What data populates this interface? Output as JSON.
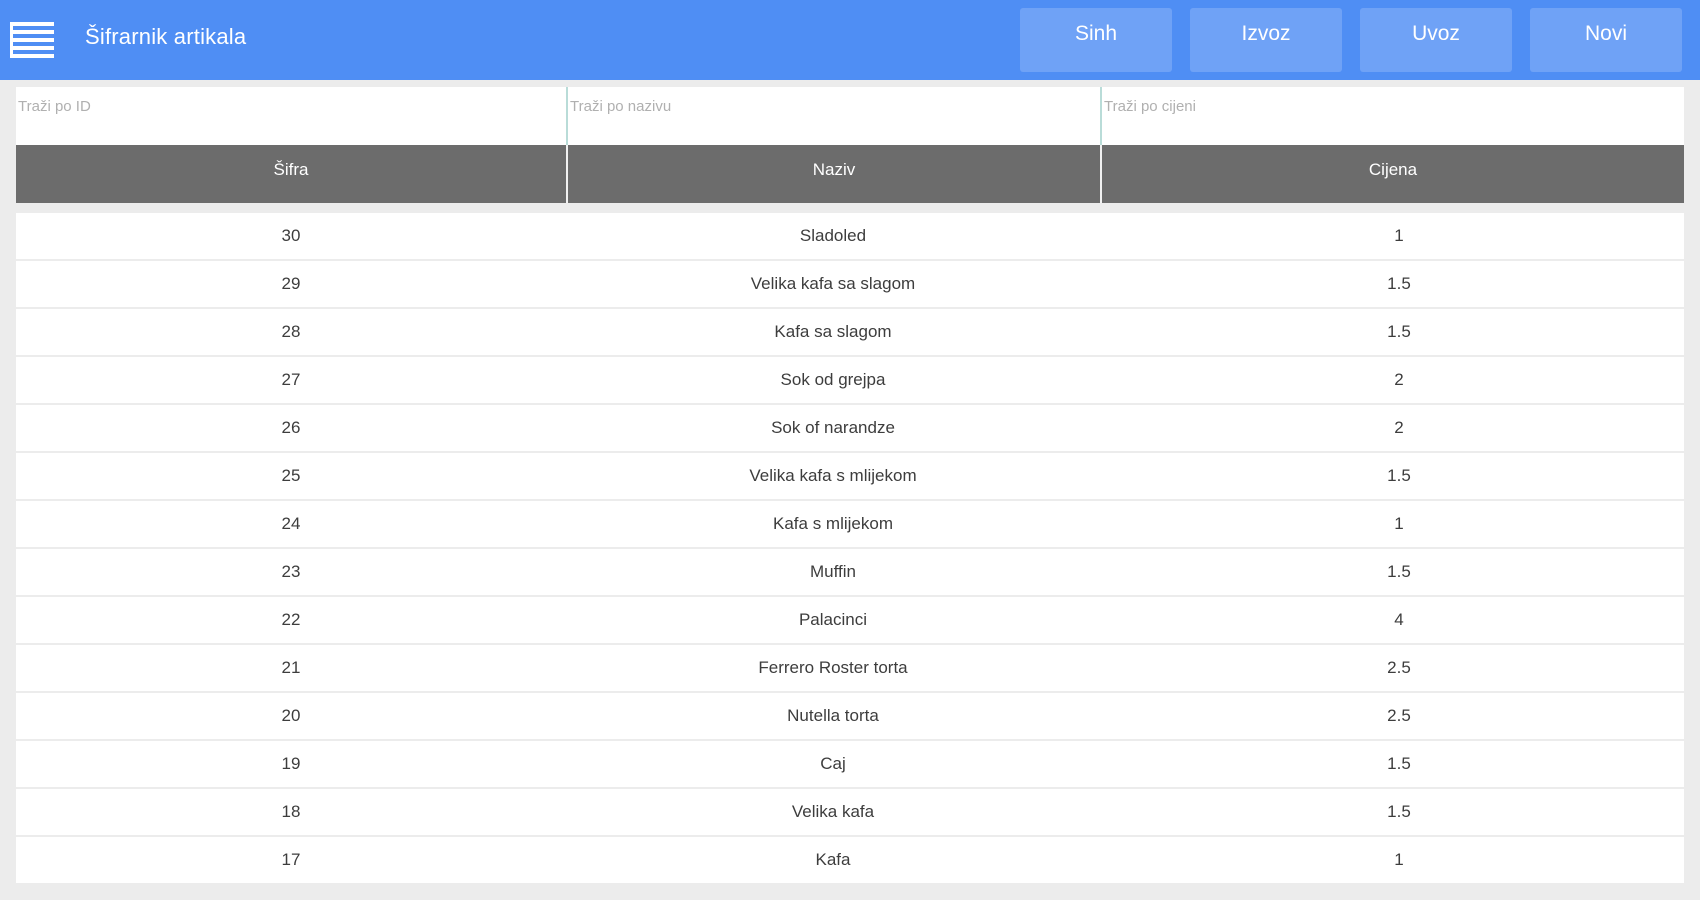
{
  "header": {
    "title": "Šifrarnik artikala",
    "menu_icon": "hamburger-menu-icon",
    "accent_color": "#4f8ef4",
    "buttons": [
      {
        "id": "sync",
        "label": "Sinh"
      },
      {
        "id": "export",
        "label": "Izvoz"
      },
      {
        "id": "import",
        "label": "Uvoz"
      },
      {
        "id": "new",
        "label": "Novi"
      }
    ]
  },
  "filters": {
    "id_placeholder": "Traži po ID",
    "name_placeholder": "Traži po nazivu",
    "price_placeholder": "Traži po cijeni"
  },
  "table": {
    "columns": [
      "Šifra",
      "Naziv",
      "Cijena"
    ],
    "rows": [
      {
        "sifra": "30",
        "naziv": "Sladoled",
        "cijena": "1"
      },
      {
        "sifra": "29",
        "naziv": "Velika kafa sa slagom",
        "cijena": "1.5"
      },
      {
        "sifra": "28",
        "naziv": "Kafa sa slagom",
        "cijena": "1.5"
      },
      {
        "sifra": "27",
        "naziv": "Sok od grejpa",
        "cijena": "2"
      },
      {
        "sifra": "26",
        "naziv": "Sok of narandze",
        "cijena": "2"
      },
      {
        "sifra": "25",
        "naziv": "Velika kafa s mlijekom",
        "cijena": "1.5"
      },
      {
        "sifra": "24",
        "naziv": "Kafa s mlijekom",
        "cijena": "1"
      },
      {
        "sifra": "23",
        "naziv": "Muffin",
        "cijena": "1.5"
      },
      {
        "sifra": "22",
        "naziv": "Palacinci",
        "cijena": "4"
      },
      {
        "sifra": "21",
        "naziv": "Ferrero Roster torta",
        "cijena": "2.5"
      },
      {
        "sifra": "20",
        "naziv": "Nutella torta",
        "cijena": "2.5"
      },
      {
        "sifra": "19",
        "naziv": "Caj",
        "cijena": "1.5"
      },
      {
        "sifra": "18",
        "naziv": "Velika kafa",
        "cijena": "1.5"
      },
      {
        "sifra": "17",
        "naziv": "Kafa",
        "cijena": "1"
      }
    ]
  }
}
